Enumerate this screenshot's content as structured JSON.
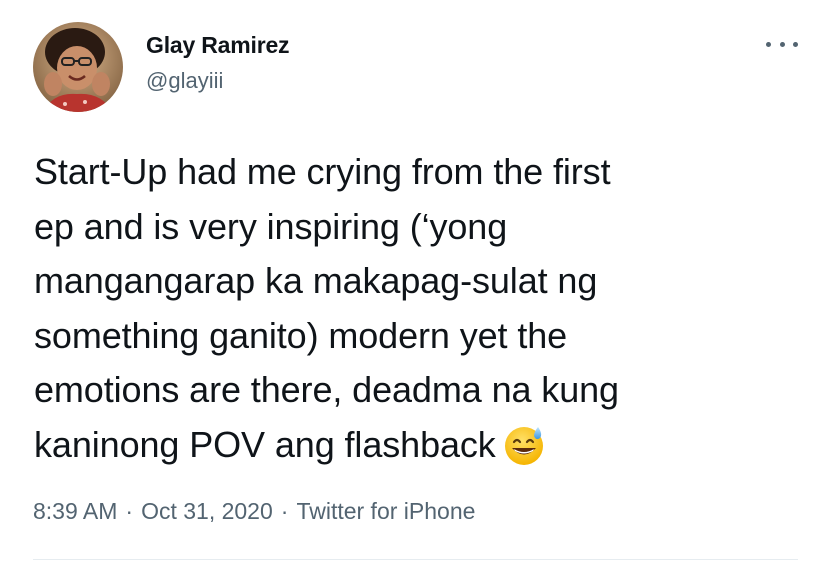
{
  "author": {
    "name": "Glay Ramirez",
    "handle": "@glayiii",
    "avatar_icon": "profile-photo"
  },
  "more_icon": "more-horizontal-icon",
  "tweet": {
    "lines": [
      "Start-Up had me crying from the first",
      "ep and is very inspiring (‘yong",
      "mangangarap ka makapag-sulat ng",
      "something ganito) modern yet the",
      "emotions are there, deadma na kung",
      "kaninong POV ang flashback"
    ],
    "emoji": "grinning-face-with-sweat"
  },
  "meta": {
    "time": "8:39 AM",
    "separator": "·",
    "date": "Oct 31, 2020",
    "source": "Twitter for iPhone"
  },
  "colors": {
    "text": "#0f1419",
    "secondary": "#536471",
    "divider": "#e6ecf0"
  }
}
